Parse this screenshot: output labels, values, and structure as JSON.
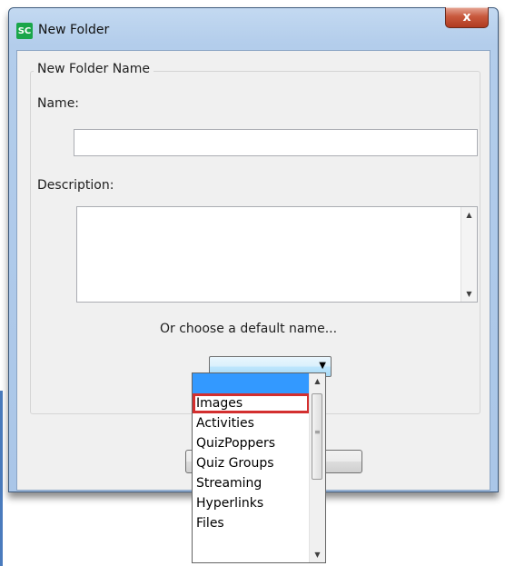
{
  "window": {
    "title": "New Folder",
    "icon_text": "SC",
    "close_glyph": "x"
  },
  "form": {
    "group_title": "New Folder Name",
    "name_label": "Name:",
    "name_value": "",
    "description_label": "Description:",
    "description_value": "",
    "default_name_label": "Or choose a default name...",
    "combo_value": ""
  },
  "dropdown": {
    "options": [
      "",
      "Images",
      "Activities",
      "QuizPoppers",
      "Quiz Groups",
      "Streaming",
      "Hyperlinks",
      "Files"
    ],
    "selected_index": 0,
    "highlighted_index": 1
  },
  "colors": {
    "selection": "#3399ff",
    "highlight_box": "#d32f2f",
    "frame": "#b3cdeb"
  }
}
